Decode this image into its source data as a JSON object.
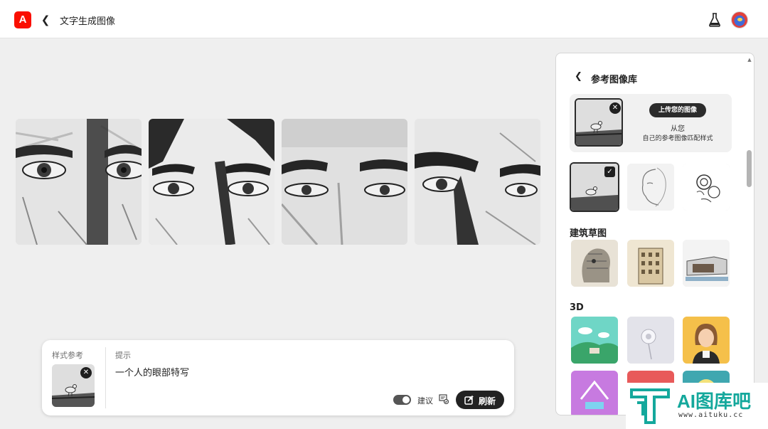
{
  "header": {
    "logo_text": "A",
    "back_icon": "chevron-left-icon",
    "title": "文字生成图像",
    "labs_icon": "flask-icon",
    "avatar_icon": "user-avatar"
  },
  "results": {
    "count": 4,
    "description_icon": "sketch-eyes-image"
  },
  "prompt_bar": {
    "style_ref_label": "样式参考",
    "prompt_label": "提示",
    "prompt_text": "一个人的眼部特写",
    "suggest_label": "建议",
    "suggest_toggle_on": true,
    "refresh_label": "刷新"
  },
  "reference_panel": {
    "title": "参考图像库",
    "upload_button": "上传您的图像",
    "upload_line1": "从您",
    "upload_line2": "自己的参考图像匹配样式",
    "sections": [
      {
        "heading": "",
        "items": [
          "seagull-sketch",
          "face-line-sketch",
          "flower-sketch"
        ],
        "selected": 0
      },
      {
        "heading": "建筑草图",
        "items": [
          "head-city-sketch",
          "building-watercolor",
          "modern-house-sketch"
        ]
      },
      {
        "heading": "3D",
        "items": [
          "3d-landscape",
          "3d-flower-white",
          "3d-cartoon-woman",
          "3d-neon",
          "3d-red",
          "3d-sun"
        ]
      }
    ]
  },
  "watermark": {
    "text": "AI图库吧",
    "url": "www.aituku.cc"
  },
  "colors": {
    "adobe_red": "#fa0f00",
    "watermark_teal": "#14a89c",
    "button_dark": "#222222"
  }
}
